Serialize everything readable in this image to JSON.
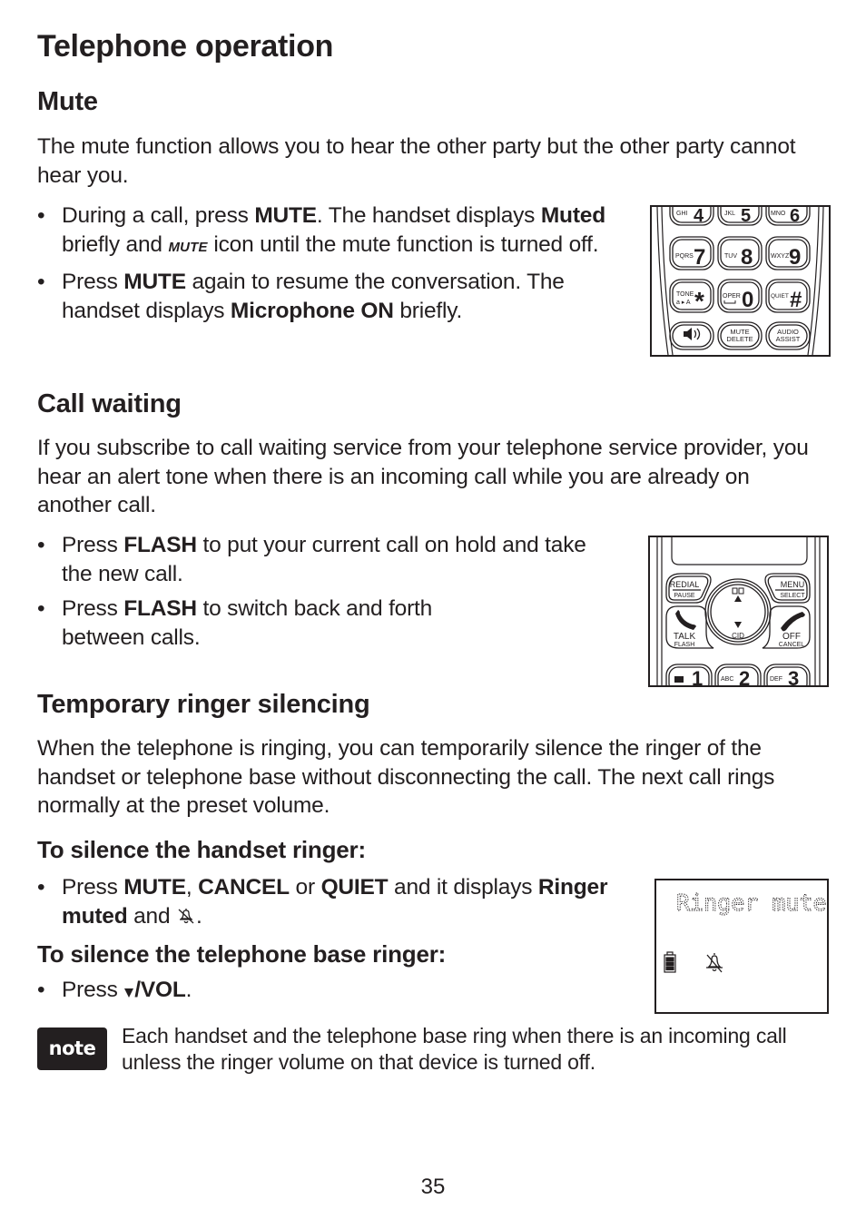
{
  "page_title": "Telephone operation",
  "sections": {
    "mute": {
      "heading": "Mute",
      "intro": "The mute function allows you to hear the other party but the other party cannot hear you.",
      "bullets": [
        {
          "t1": "During a call, press ",
          "b1": "MUTE",
          "t2": ". The handset displays ",
          "b2": "Muted",
          "t3": " briefly and ",
          "icon_label": "MUTE",
          "t4": " icon until the mute function is turned off."
        },
        {
          "t1": "Press ",
          "b1": "MUTE",
          "t2": " again to resume the conversation. The handset displays ",
          "b2": "Microphone ON",
          "t3": " briefly."
        }
      ],
      "figure_keys": {
        "row1": [
          {
            "letters": "GHI",
            "digit": "4"
          },
          {
            "letters": "JKL",
            "digit": "5"
          },
          {
            "letters": "MNO",
            "digit": "6"
          }
        ],
        "row2": [
          {
            "letters": "PQRS",
            "digit": "7"
          },
          {
            "letters": "TUV",
            "digit": "8"
          },
          {
            "letters": "WXYZ",
            "digit": "9"
          }
        ],
        "row3": [
          {
            "letters": "TONE",
            "sub": "a▸A",
            "digit": "*"
          },
          {
            "letters": "OPER",
            "digit": "0"
          },
          {
            "letters": "QUIET",
            "digit": "#"
          }
        ],
        "row4": [
          {
            "label": "speaker-icon"
          },
          {
            "top": "MUTE",
            "bottom": "DELETE"
          },
          {
            "top": "AUDIO",
            "bottom": "ASSIST"
          }
        ]
      }
    },
    "call_waiting": {
      "heading": "Call waiting",
      "intro": "If you subscribe to call waiting service from your telephone service provider, you hear an alert tone when there is an incoming call while you are already on another call.",
      "bullets": [
        {
          "t1": "Press ",
          "b1": "FLASH",
          "t2": " to put your current call on hold and take the new call."
        },
        {
          "t1": "Press ",
          "b1": "FLASH",
          "t2": " to switch back and forth between calls."
        }
      ],
      "figure_keys": {
        "redial": "REDIAL",
        "pause": "PAUSE",
        "menu": "MENU",
        "select": "SELECT",
        "talk": "TALK",
        "flash": "FLASH",
        "off": "OFF",
        "cancel": "CANCEL",
        "cid": "CID",
        "row1": [
          {
            "letters": "",
            "digit": "1"
          },
          {
            "letters": "ABC",
            "digit": "2"
          },
          {
            "letters": "DEF",
            "digit": "3"
          }
        ]
      }
    },
    "ringer": {
      "heading": "Temporary ringer silencing",
      "intro": "When the telephone is ringing, you can temporarily silence the ringer of the handset or telephone base without disconnecting the call. The next call rings normally at the preset volume.",
      "handset": {
        "subheading": "To silence the handset ringer:",
        "t1": "Press ",
        "b1": "MUTE",
        "t2": ", ",
        "b2": "CANCEL",
        "t3": " or ",
        "b3": "QUIET",
        "t4": " and it displays ",
        "b4": "Ringer muted",
        "t5": " and ",
        "t6": "."
      },
      "base": {
        "subheading": "To silence the telephone base ringer:",
        "t1": "Press ",
        "b1": "/VOL",
        "t2": "."
      },
      "screen_text": "Ringer muted"
    }
  },
  "note": {
    "badge": "note",
    "text": "Each handset and the telephone base ring when there is an incoming call unless the ringer volume on that device is turned off."
  },
  "page_number": "35"
}
